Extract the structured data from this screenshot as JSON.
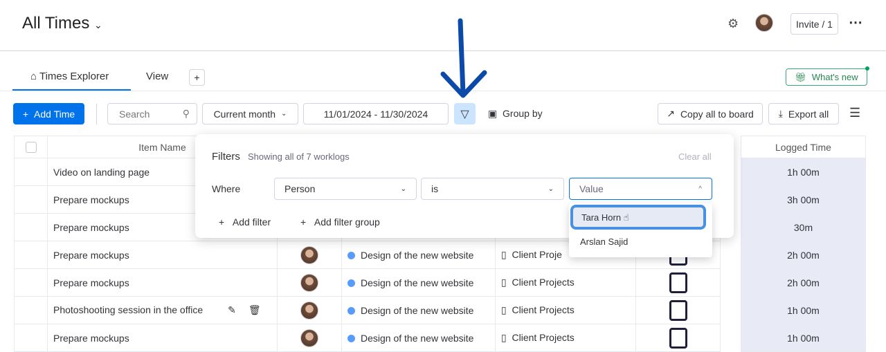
{
  "header": {
    "title": "All Times",
    "invite_label": "Invite / 1"
  },
  "tabs": [
    {
      "label": "Times Explorer"
    },
    {
      "label": "View"
    }
  ],
  "add_tab": "+",
  "whats_new": "What's new",
  "toolbar": {
    "add_time": "Add Time",
    "search_placeholder": "Search",
    "period": "Current month",
    "date_range": "11/01/2024 - 11/30/2024",
    "group_by": "Group by",
    "copy_all": "Copy all to board",
    "export_all": "Export all"
  },
  "table": {
    "headers": {
      "item_name": "Item Name",
      "logged_time": "Logged Time"
    },
    "rows": [
      {
        "item": "Video on landing page",
        "group": "",
        "board": "",
        "logged": "1h 00m"
      },
      {
        "item": "Prepare mockups",
        "group": "",
        "board": "",
        "logged": "3h 00m"
      },
      {
        "item": "Prepare mockups",
        "group": "",
        "board": "",
        "logged": "30m"
      },
      {
        "item": "Prepare mockups",
        "group": "Design of the new website",
        "board": "Client Proje",
        "logged": "2h 00m"
      },
      {
        "item": "Prepare mockups",
        "group": "Design of the new website",
        "board": "Client Projects",
        "logged": "2h 00m"
      },
      {
        "item": "Photoshooting session in the office",
        "group": "Design of the new website",
        "board": "Client Projects",
        "logged": "1h 00m"
      },
      {
        "item": "Prepare mockups",
        "group": "Design of the new website",
        "board": "Client Projects",
        "logged": "1h 00m"
      }
    ]
  },
  "filters": {
    "title": "Filters",
    "summary": "Showing all of 7 worklogs",
    "clear_all": "Clear all",
    "where": "Where",
    "column": "Person",
    "operator": "is",
    "value_placeholder": "Value",
    "add_filter": "Add filter",
    "add_filter_group": "Add filter group",
    "options": [
      "Tara Horn",
      "Arslan Sajid"
    ]
  },
  "colors": {
    "accent": "#0073ea",
    "annotation_arrow": "#0b4aa8",
    "logged_bg": "#e8eaf5"
  }
}
